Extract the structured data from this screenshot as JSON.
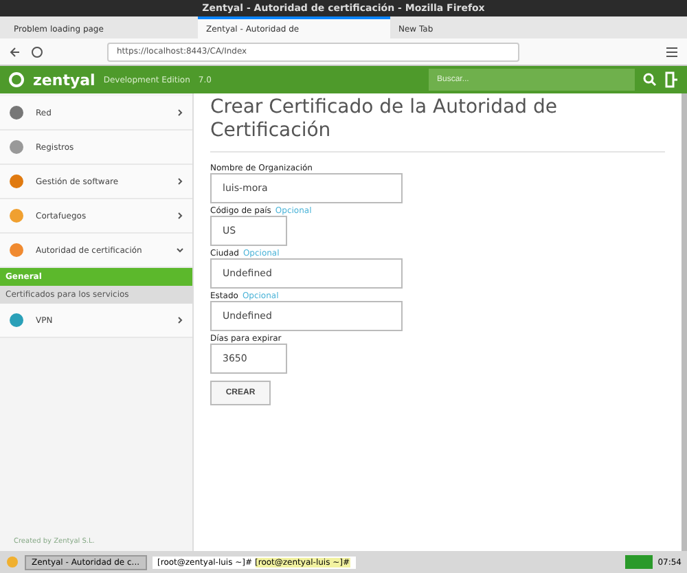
{
  "window": {
    "title": "Zentyal - Autoridad de certificación - Mozilla Firefox"
  },
  "tabs": [
    {
      "label": "Problem loading page",
      "selected": false
    },
    {
      "label": "Zentyal - Autoridad de",
      "selected": true
    },
    {
      "label": "New Tab",
      "selected": false
    }
  ],
  "address_bar": {
    "url": "https://localhost:8443/CA/Index"
  },
  "header": {
    "brand": "zentyal",
    "edition": "Development Edition",
    "version": "7.0",
    "search": {
      "placeholder": "Buscar..."
    }
  },
  "sidebar": {
    "items": [
      {
        "label": "Red",
        "kind": "group",
        "expanded": false
      },
      {
        "label": "Registros",
        "kind": "link"
      },
      {
        "label": "Gestión de software",
        "kind": "group",
        "expanded": false
      },
      {
        "label": "Cortafuegos",
        "kind": "group",
        "expanded": false
      },
      {
        "label": "Autoridad de certificación",
        "kind": "group",
        "expanded": true,
        "children": [
          {
            "label": "General",
            "selected": true
          },
          {
            "label": "Certificados para los servicios",
            "selected": false
          }
        ]
      },
      {
        "label": "VPN",
        "kind": "group",
        "expanded": false
      }
    ]
  },
  "footer": {
    "text": "Created by Zentyal S.L."
  },
  "page": {
    "title": "Crear Certificado de la Autoridad de Certificación",
    "fields": [
      {
        "label": "Nombre de Organización",
        "value": "luis-mora",
        "kind": "long"
      },
      {
        "label": "Código de país",
        "optional": "Opcional",
        "value": "US",
        "kind": "short"
      },
      {
        "label": "Ciudad",
        "optional": "Opcional",
        "value": "Undefined",
        "kind": "long"
      },
      {
        "label": "Estado",
        "optional": "Opcional",
        "value": "Undefined",
        "kind": "long"
      },
      {
        "label": "Días para expirar",
        "value": "3650",
        "kind": "short"
      }
    ],
    "button": "CREAR"
  },
  "taskbar": {
    "window": "Zentyal - Autoridad de c...",
    "terminal": "[root@zentyal-luis ~]# ",
    "terminal_title": "[root@zentyal-luis ~]#",
    "time": "07:54"
  }
}
